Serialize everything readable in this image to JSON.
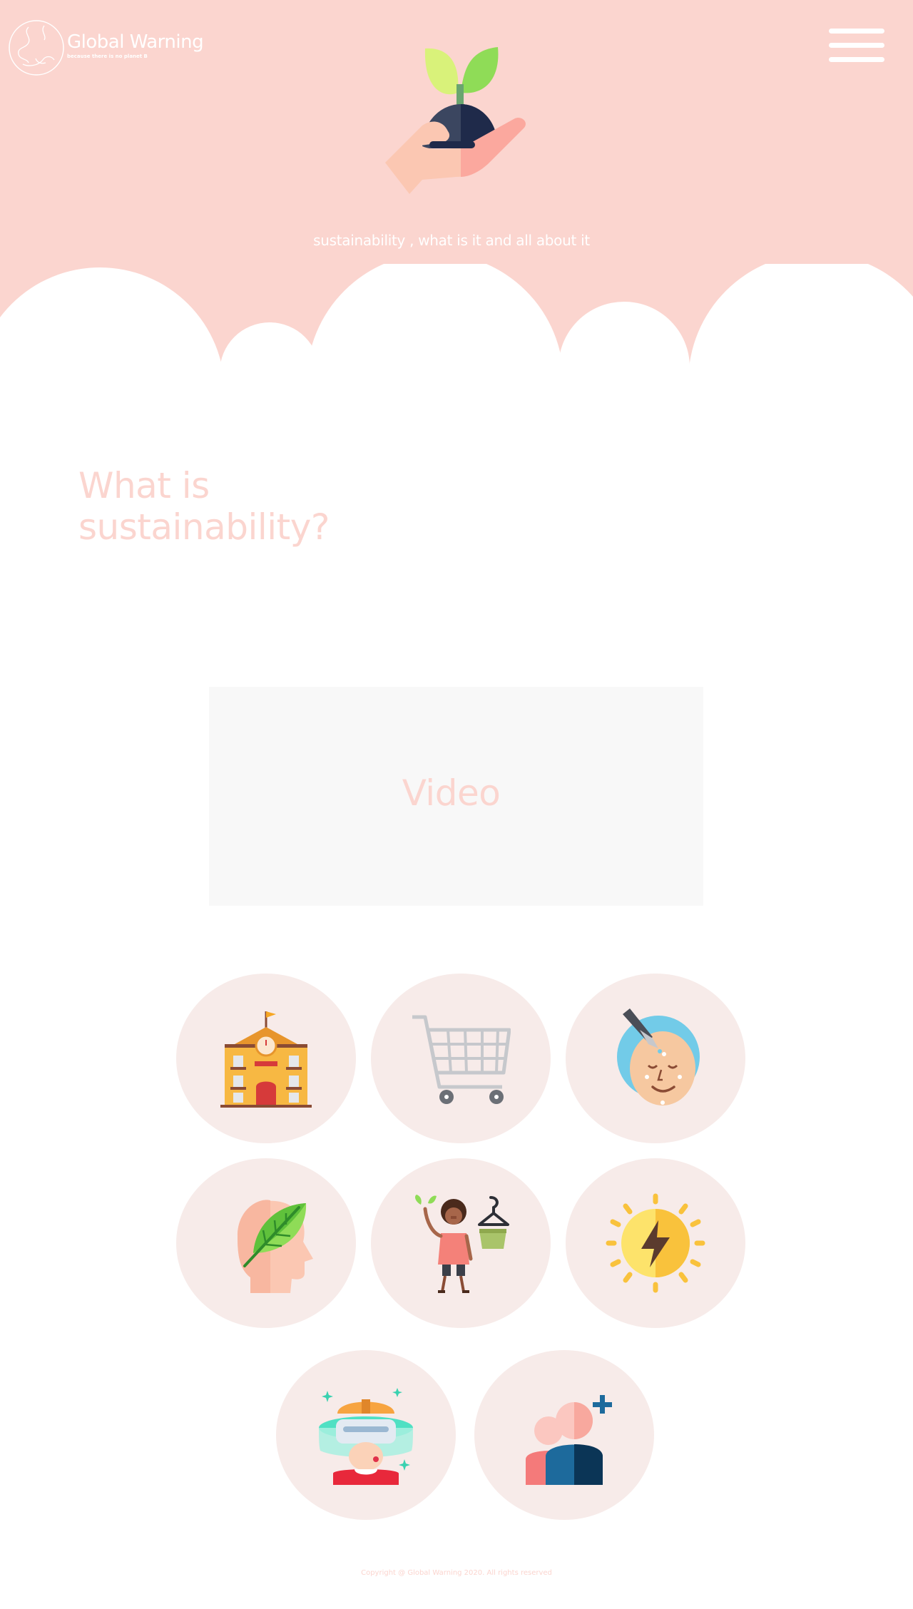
{
  "header": {
    "brand_title": "Global Warning",
    "brand_tagline": "because there is no planet B",
    "menu_icon": "hamburger-menu-icon",
    "hero_icon": "plant-in-hand-icon",
    "subtitle": "sustainability , what is it and all about it"
  },
  "intro": {
    "title_line1": "What is",
    "title_line2": "sustainability?"
  },
  "video": {
    "label": "Video"
  },
  "topics": [
    {
      "icon": "school-building-icon"
    },
    {
      "icon": "shopping-cart-icon"
    },
    {
      "icon": "skincare-face-icon"
    },
    {
      "icon": "green-mind-icon"
    },
    {
      "icon": "sustainable-fashion-icon"
    },
    {
      "icon": "solar-energy-icon"
    },
    {
      "icon": "virtual-reality-icon"
    },
    {
      "icon": "add-people-icon"
    }
  ],
  "footer": {
    "copyright": "Copyright @ Global Warning 2020. All rights reserved"
  },
  "colors": {
    "hero_background": "#fbd5cf",
    "accent_text": "#fbd5cf",
    "topic_circle": "#f7ebe9",
    "video_background": "#f8f8f8"
  }
}
